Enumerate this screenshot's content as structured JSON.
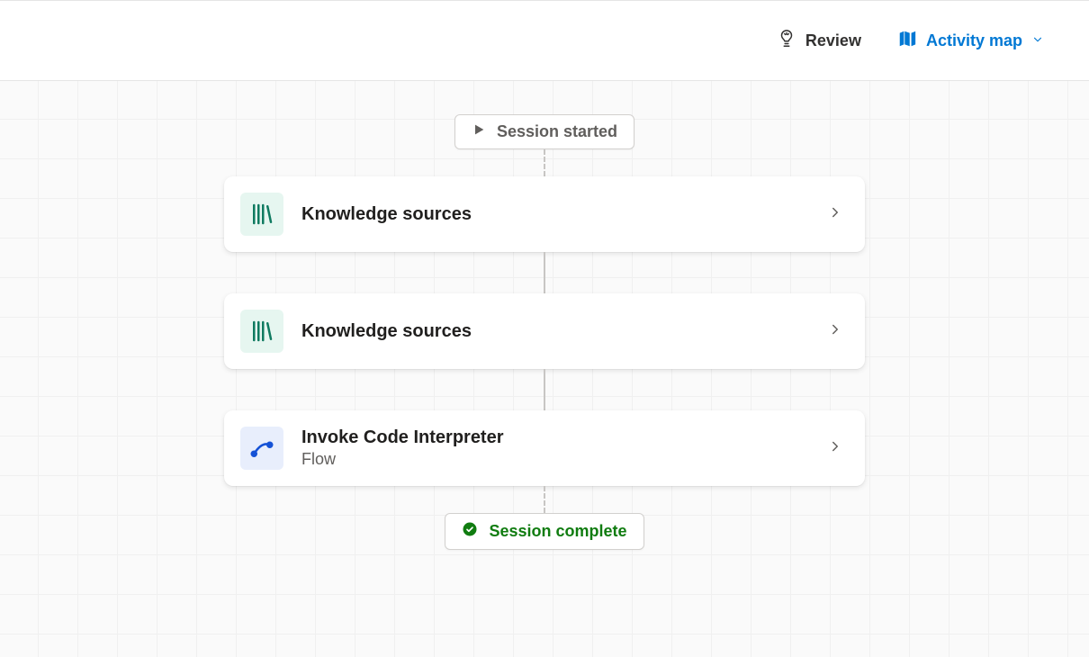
{
  "header": {
    "review_label": "Review",
    "activity_map_label": "Activity map"
  },
  "flow": {
    "start_label": "Session started",
    "end_label": "Session complete",
    "steps": [
      {
        "title": "Knowledge sources",
        "subtitle": "",
        "icon": "knowledge"
      },
      {
        "title": "Knowledge sources",
        "subtitle": "",
        "icon": "knowledge"
      },
      {
        "title": "Invoke Code Interpreter",
        "subtitle": "Flow",
        "icon": "flow"
      }
    ]
  },
  "colors": {
    "accent": "#0078d4",
    "success": "#107c10",
    "knowledge_icon_bg": "#e6f6f0",
    "knowledge_icon_fg": "#0f7a60",
    "flow_icon_bg": "#e8eefc",
    "flow_icon_fg": "#1552d6"
  }
}
